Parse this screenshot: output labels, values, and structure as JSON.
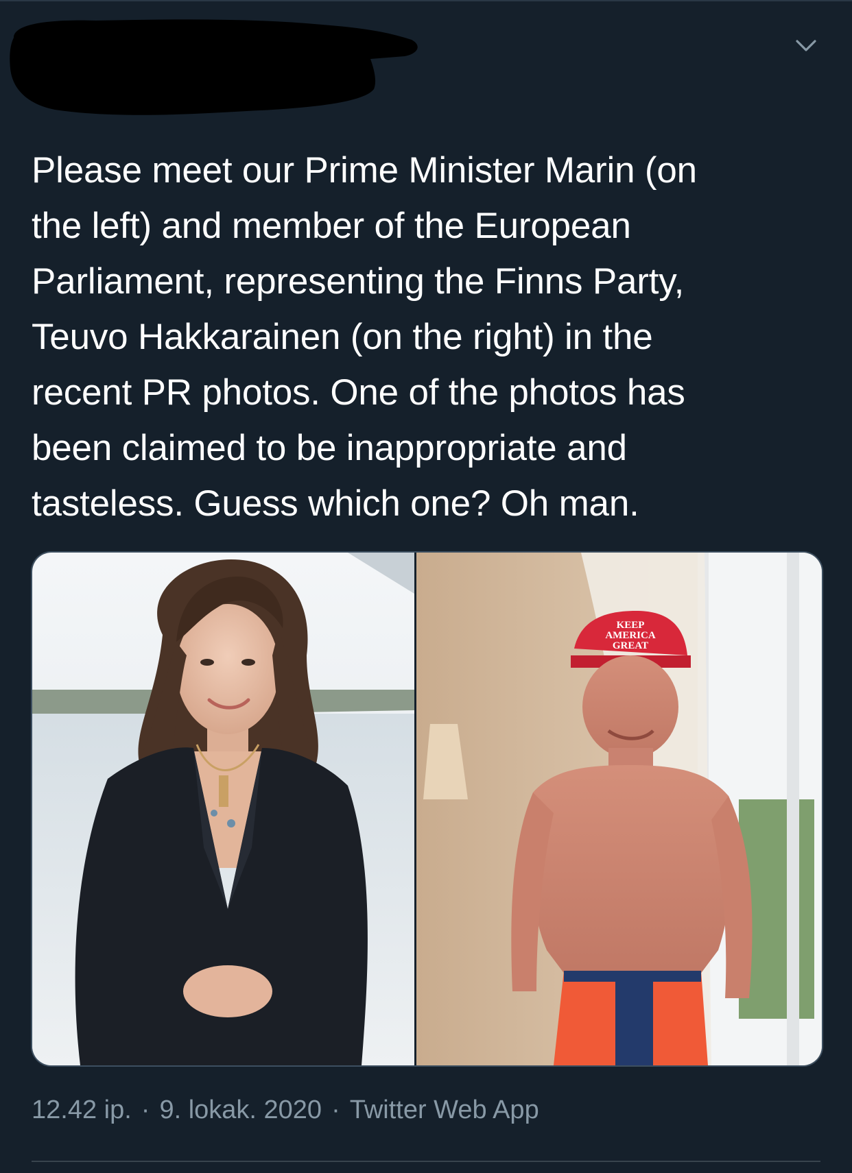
{
  "tweet": {
    "author_name": "",
    "text": "Please meet our Prime Minister Marin (on\nthe left) and member of the European\nParliament, representing the Finns Party,\nTeuvo Hakkarainen (on the right) in the\nrecent PR photos. One of the photos has\nbeen claimed to be inappropriate and\ntasteless. Guess which one? Oh man.",
    "time": "12.42 ip.",
    "separator": "·",
    "date": "9. lokak. 2020",
    "source": "Twitter Web App"
  },
  "media": {
    "right_photo_cap_text": [
      "KEEP",
      "AMERICA",
      "GREAT"
    ]
  },
  "icons": {
    "menu": "chevron-down-icon"
  },
  "colors": {
    "background": "#15202b",
    "text": "#ffffff",
    "meta_text": "#8899a6",
    "divider": "#38444d"
  }
}
